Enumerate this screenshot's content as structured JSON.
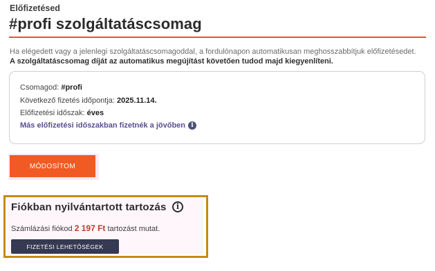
{
  "header": {
    "eyebrow": "Előfizetésed",
    "title": "#profi szolgáltatáscsomag"
  },
  "intro": {
    "text": "Ha elégedett vagy a jelenlegi szolgáltatáscsomagoddal, a fordulónapon automatikusan meghosszabbítjuk előfizetésedet.",
    "strong_text": "A szolgáltatáscsomag díját az automatikus megújítást követően tudod majd kiegyenlíteni."
  },
  "details": {
    "package_label": "Csomagod:",
    "package_value": "#profi",
    "next_payment_label": "Következő fizetés időpontja:",
    "next_payment_value": "2025.11.14.",
    "period_label": "Előfizetési időszak:",
    "period_value": "éves",
    "link_text": "Más előfizetési időszakban fizetnék a jövőben",
    "link_icon": "info-icon"
  },
  "actions": {
    "modify_label": "MÓDOSÍTOM"
  },
  "debt": {
    "title": "Fiókban nyilvántartott tartozás",
    "info_icon": "info-circle-icon",
    "text_before": "Számlázási fiókod",
    "amount": "2 197 Ft",
    "text_after": "tartozást mutat.",
    "pay_label": "FIZETÉSI LEHETŐSÉGEK"
  },
  "colors": {
    "accent": "#f15a22",
    "rule": "#f4511e",
    "highlight_border": "#c58a12",
    "dark_button": "#353a52",
    "link": "#5a4f8f",
    "amount": "#c0392b"
  }
}
